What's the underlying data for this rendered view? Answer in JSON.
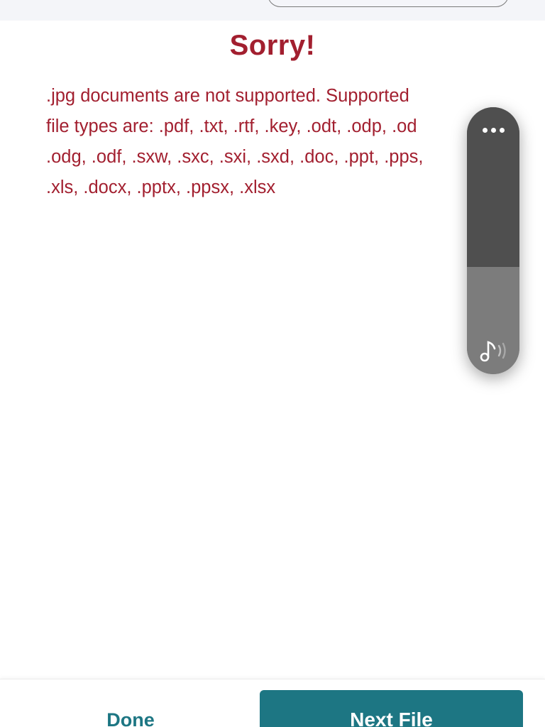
{
  "dialog": {
    "title": "Sorry!",
    "message": ".jpg documents are not supported. Supported\nfile types are: .pdf, .txt, .rtf, .key, .odt, .odp, .od\n.odg, .odf, .sxw, .sxc, .sxi, .sxd, .doc, .ppt, .pps,\n.xls, .docx, .pptx, .ppsx, .xlsx"
  },
  "volume_hud": {
    "level": 0.4,
    "more_icon": "more-horizontal-icon",
    "music_icon": "music-note-icon"
  },
  "footer": {
    "done_label": "Done",
    "next_label": "Next File"
  },
  "colors": {
    "error_text": "#a21f2f",
    "accent": "#1d7683",
    "top_strip": "#f4f5f9"
  }
}
